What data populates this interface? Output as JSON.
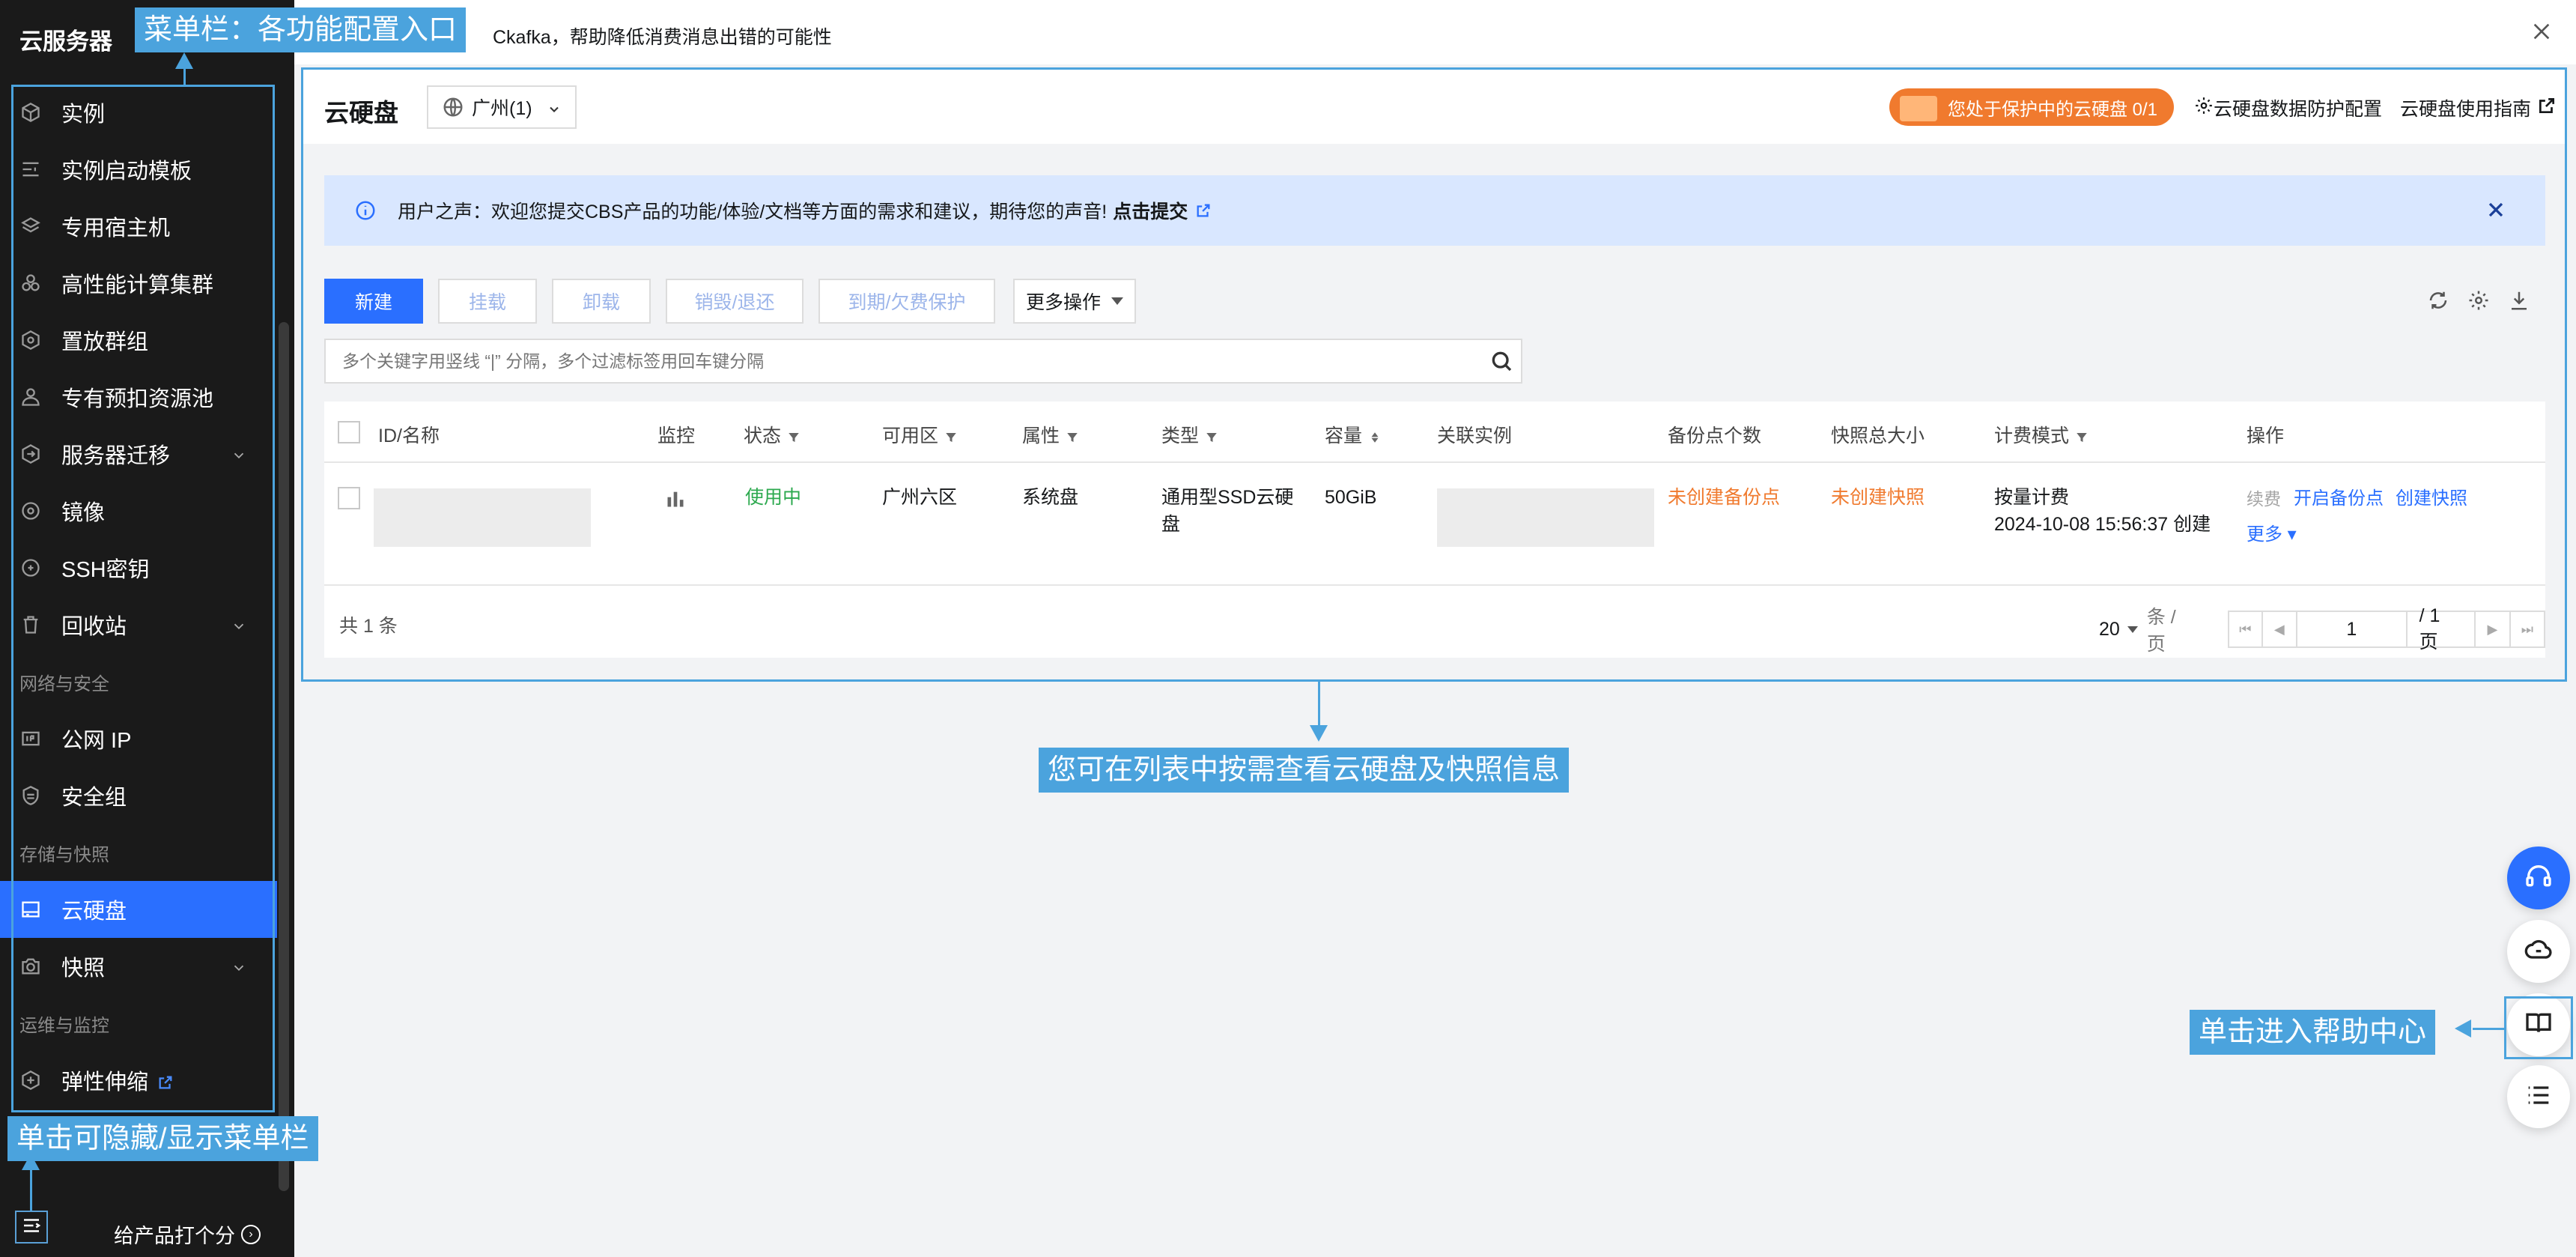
{
  "sidebar": {
    "brand": "云服务器",
    "items": [
      {
        "label": "实例"
      },
      {
        "label": "实例启动模板"
      },
      {
        "label": "专用宿主机"
      },
      {
        "label": "高性能计算集群"
      },
      {
        "label": "置放群组"
      },
      {
        "label": "专有预扣资源池"
      },
      {
        "label": "服务器迁移"
      },
      {
        "label": "镜像"
      },
      {
        "label": "SSH密钥"
      },
      {
        "label": "回收站"
      }
    ],
    "group_network": "网络与安全",
    "network_items": [
      {
        "label": "公网 IP"
      },
      {
        "label": "安全组"
      }
    ],
    "group_storage": "存储与快照",
    "storage_items": [
      {
        "label": "云硬盘"
      },
      {
        "label": "快照"
      }
    ],
    "group_ops": "运维与监控",
    "ops_items": [
      {
        "label": "弹性伸缩"
      }
    ],
    "rate_label": "给产品打个分"
  },
  "top_notice": {
    "text": "Ckafka，帮助降低消费消息出错的可能性"
  },
  "header": {
    "title": "云硬盘",
    "region": "广州(1)",
    "protect_badge": "您处于保护中的云硬盘 0/1",
    "protect_config": "云硬盘数据防护配置",
    "guide": "云硬盘使用指南"
  },
  "voice": {
    "text": "用户之声：欢迎您提交CBS产品的功能/体验/文档等方面的需求和建议，期待您的声音!",
    "link": "点击提交"
  },
  "toolbar": {
    "new": "新建",
    "mount": "挂载",
    "unmount": "卸载",
    "destroy": "销毁/退还",
    "expire": "到期/欠费保护",
    "more": "更多操作"
  },
  "search": {
    "placeholder": "多个关键字用竖线 “|” 分隔，多个过滤标签用回车键分隔"
  },
  "table": {
    "headers": {
      "id": "ID/名称",
      "monitor": "监控",
      "status": "状态",
      "zone": "可用区",
      "attr": "属性",
      "type": "类型",
      "capacity": "容量",
      "instance": "关联实例",
      "backup": "备份点个数",
      "snapshot": "快照总大小",
      "billing": "计费模式",
      "ops": "操作"
    },
    "row": {
      "status": "使用中",
      "zone": "广州六区",
      "attr": "系统盘",
      "type": "通用型SSD云硬盘",
      "capacity": "50GiB",
      "backup": "未创建备份点",
      "snapshot": "未创建快照",
      "billing_mode": "按量计费",
      "created": "2024-10-08 15:56:37 创建",
      "op_renew": "续费",
      "op_backup": "开启备份点",
      "op_snapshot": "创建快照",
      "op_more": "更多"
    },
    "total": "共 1 条",
    "page_size": "20",
    "page_unit": "条 / 页",
    "page_current": "1",
    "page_of": "/ 1 页"
  },
  "annotations": {
    "menu": "菜单栏：各功能配置入口",
    "list": "您可在列表中按需查看云硬盘及快照信息",
    "help": "单击进入帮助中心",
    "toggle": "单击可隐藏/显示菜单栏"
  },
  "colors": {
    "primary": "#2a6fff",
    "sidebar_bg": "#1a1a1a",
    "annotation": "#4ba3dd",
    "status_ok": "#2da94f",
    "warning": "#f07a2e"
  }
}
